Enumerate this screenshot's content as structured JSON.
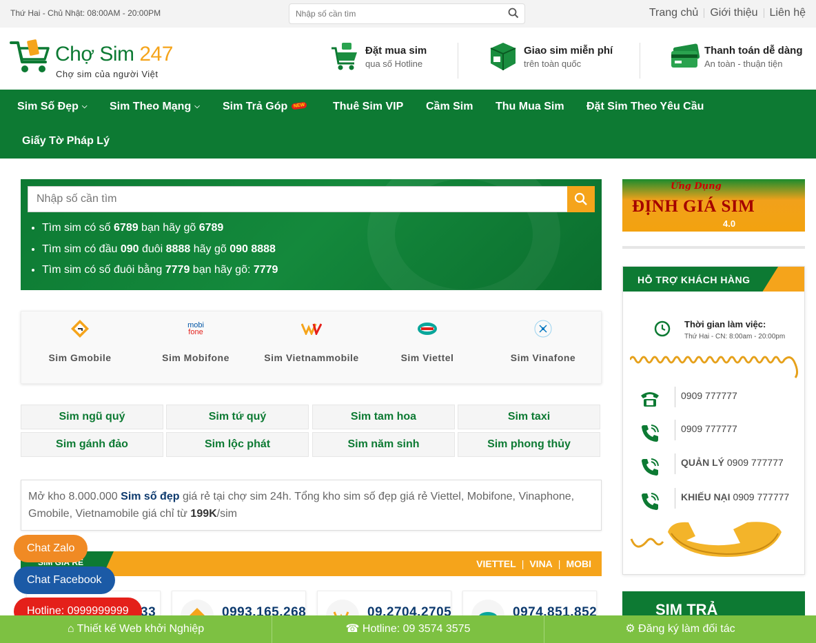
{
  "topbar": {
    "hours": "Thứ Hai - Chủ Nhật: 08:00AM - 20:00PM",
    "search_placeholder": "Nhập số cần tìm",
    "links": [
      "Trang chủ",
      "Giới thiệu",
      "Liên hệ"
    ]
  },
  "header": {
    "logo_name_part1": "Chợ Sim",
    "logo_name_part2": "247",
    "logo_tagline": "Chợ sim của người Việt",
    "features": [
      {
        "title": "Đặt mua sim",
        "subtitle": "qua số Hotline",
        "icon": "cart-icon"
      },
      {
        "title": "Giao sim miễn phí",
        "subtitle": "trên toàn quốc",
        "icon": "package-icon"
      },
      {
        "title": "Thanh toán dễ dàng",
        "subtitle": "An toàn - thuận tiện",
        "icon": "card-icon"
      }
    ]
  },
  "nav": {
    "items": [
      "Sim Số Đẹp",
      "Sim Theo Mạng",
      "Sim Trả Góp",
      "Thuê Sim VIP",
      "Cầm Sim",
      "Thu Mua Sim",
      "Đặt Sim Theo Yêu Cầu",
      "Giấy Tờ Pháp Lý"
    ],
    "new_badge": "NEW"
  },
  "hero": {
    "search_placeholder": "Nhập số cần tìm",
    "tips": [
      {
        "a": "Tìm sim có số ",
        "b": "6789",
        "c": " bạn hãy gõ ",
        "d": "6789",
        "e": "",
        "f": ""
      },
      {
        "a": "Tìm sim có đầu ",
        "b": "090",
        "c": " đuôi ",
        "d": "8888",
        "e": " hãy gõ ",
        "f": "090 8888"
      },
      {
        "a": "Tìm sim có số đuôi bằng ",
        "b": "7779",
        "c": " bạn hãy gõ: ",
        "d": "7779",
        "e": "",
        "f": ""
      }
    ]
  },
  "networks": [
    {
      "label": "Sim Gmobile",
      "icon": "gmobile-logo-icon"
    },
    {
      "label": "Sim Mobifone",
      "icon": "mobifone-logo-icon",
      "logo_text_1": "mobi",
      "logo_text_2": "fone"
    },
    {
      "label": "Sim Vietnammobile",
      "icon": "vietnamobile-logo-icon"
    },
    {
      "label": "Sim Viettel",
      "icon": "viettel-logo-icon"
    },
    {
      "label": "Sim Vinafone",
      "icon": "vinaphone-logo-icon"
    }
  ],
  "categories": [
    "Sim ngũ quý",
    "Sim tứ quý",
    "Sim tam hoa",
    "Sim taxi",
    "Sim gánh đảo",
    "Sim lộc phát",
    "Sim năm sinh",
    "Sim phong thủy"
  ],
  "description": {
    "p1": "Mở kho 8.000.000 ",
    "b1": "Sim số đẹp",
    "p2": " giá rẻ tại chợ sim 24h. Tổng kho sim số đẹp giá rẻ Viettel, Mobifone, Vinaphone, Gmobile, Vietnamobile giá chỉ từ ",
    "b2": "199K",
    "p3": "/sim"
  },
  "sim_section": {
    "tab": "SIM GIÁ RẺ",
    "links": [
      "VIETTEL",
      "VINA",
      "MOBI"
    ],
    "sep": "|"
  },
  "sim_cards": [
    {
      "number": "33"
    },
    {
      "number": "0993.165.268"
    },
    {
      "number": "09.2704.2705"
    },
    {
      "number": "0974.851.852"
    }
  ],
  "floating": {
    "zalo": "Chat Zalo",
    "facebook": "Chat Facebook",
    "hotline": "Hotline: 0999999999"
  },
  "sidebar": {
    "app_banner": {
      "line1": "Ứng Dụng",
      "line2": "ĐỊNH GIÁ SIM",
      "line3": "4.0"
    },
    "support": {
      "title": "HỖ TRỢ KHÁCH HÀNG",
      "work_title": "Thời gian làm việc:",
      "work_hours": "Thứ Hai - CN: 8:00am - 20:00pm",
      "rows": [
        {
          "label": "",
          "phone": "0909 777777",
          "icon": "telephone-icon"
        },
        {
          "label": "",
          "phone": "0909 777777",
          "icon": "phone-call-icon"
        },
        {
          "label": "QUẢN LÝ",
          "phone": " 0909 777777",
          "icon": "phone-call-icon"
        },
        {
          "label": "KHIẾU NẠI",
          "phone": " 0909 777777",
          "icon": "phone-call-icon"
        }
      ]
    },
    "tragop_banner": "SIM TRẢ"
  },
  "footer": {
    "items": [
      {
        "label": "Thiết kế Web khởi Nghiệp",
        "icon": "home-icon"
      },
      {
        "label": "Hotline: 09 3574 3575",
        "icon": "phone-icon"
      },
      {
        "label": "Đăng ký làm đối tác",
        "icon": "gear-icon"
      }
    ]
  },
  "colors": {
    "brand_green": "#0d7a33",
    "accent_orange": "#f5a41b",
    "footer_green": "#7dc142"
  }
}
